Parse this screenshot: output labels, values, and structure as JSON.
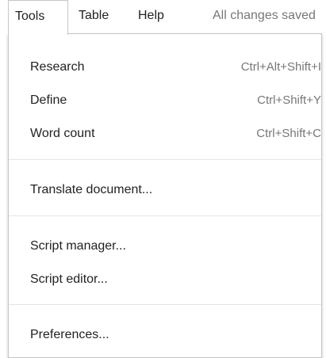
{
  "menubar": {
    "tools": "Tools",
    "table": "Table",
    "help": "Help",
    "status": "All changes saved"
  },
  "tools_menu": {
    "research": {
      "label": "Research",
      "shortcut": "Ctrl+Alt+Shift+I"
    },
    "define": {
      "label": "Define",
      "shortcut": "Ctrl+Shift+Y"
    },
    "word_count": {
      "label": "Word count",
      "shortcut": "Ctrl+Shift+C"
    },
    "translate": {
      "label": "Translate document..."
    },
    "script_manager": {
      "label": "Script manager..."
    },
    "script_editor": {
      "label": "Script editor..."
    },
    "preferences": {
      "label": "Preferences..."
    }
  }
}
